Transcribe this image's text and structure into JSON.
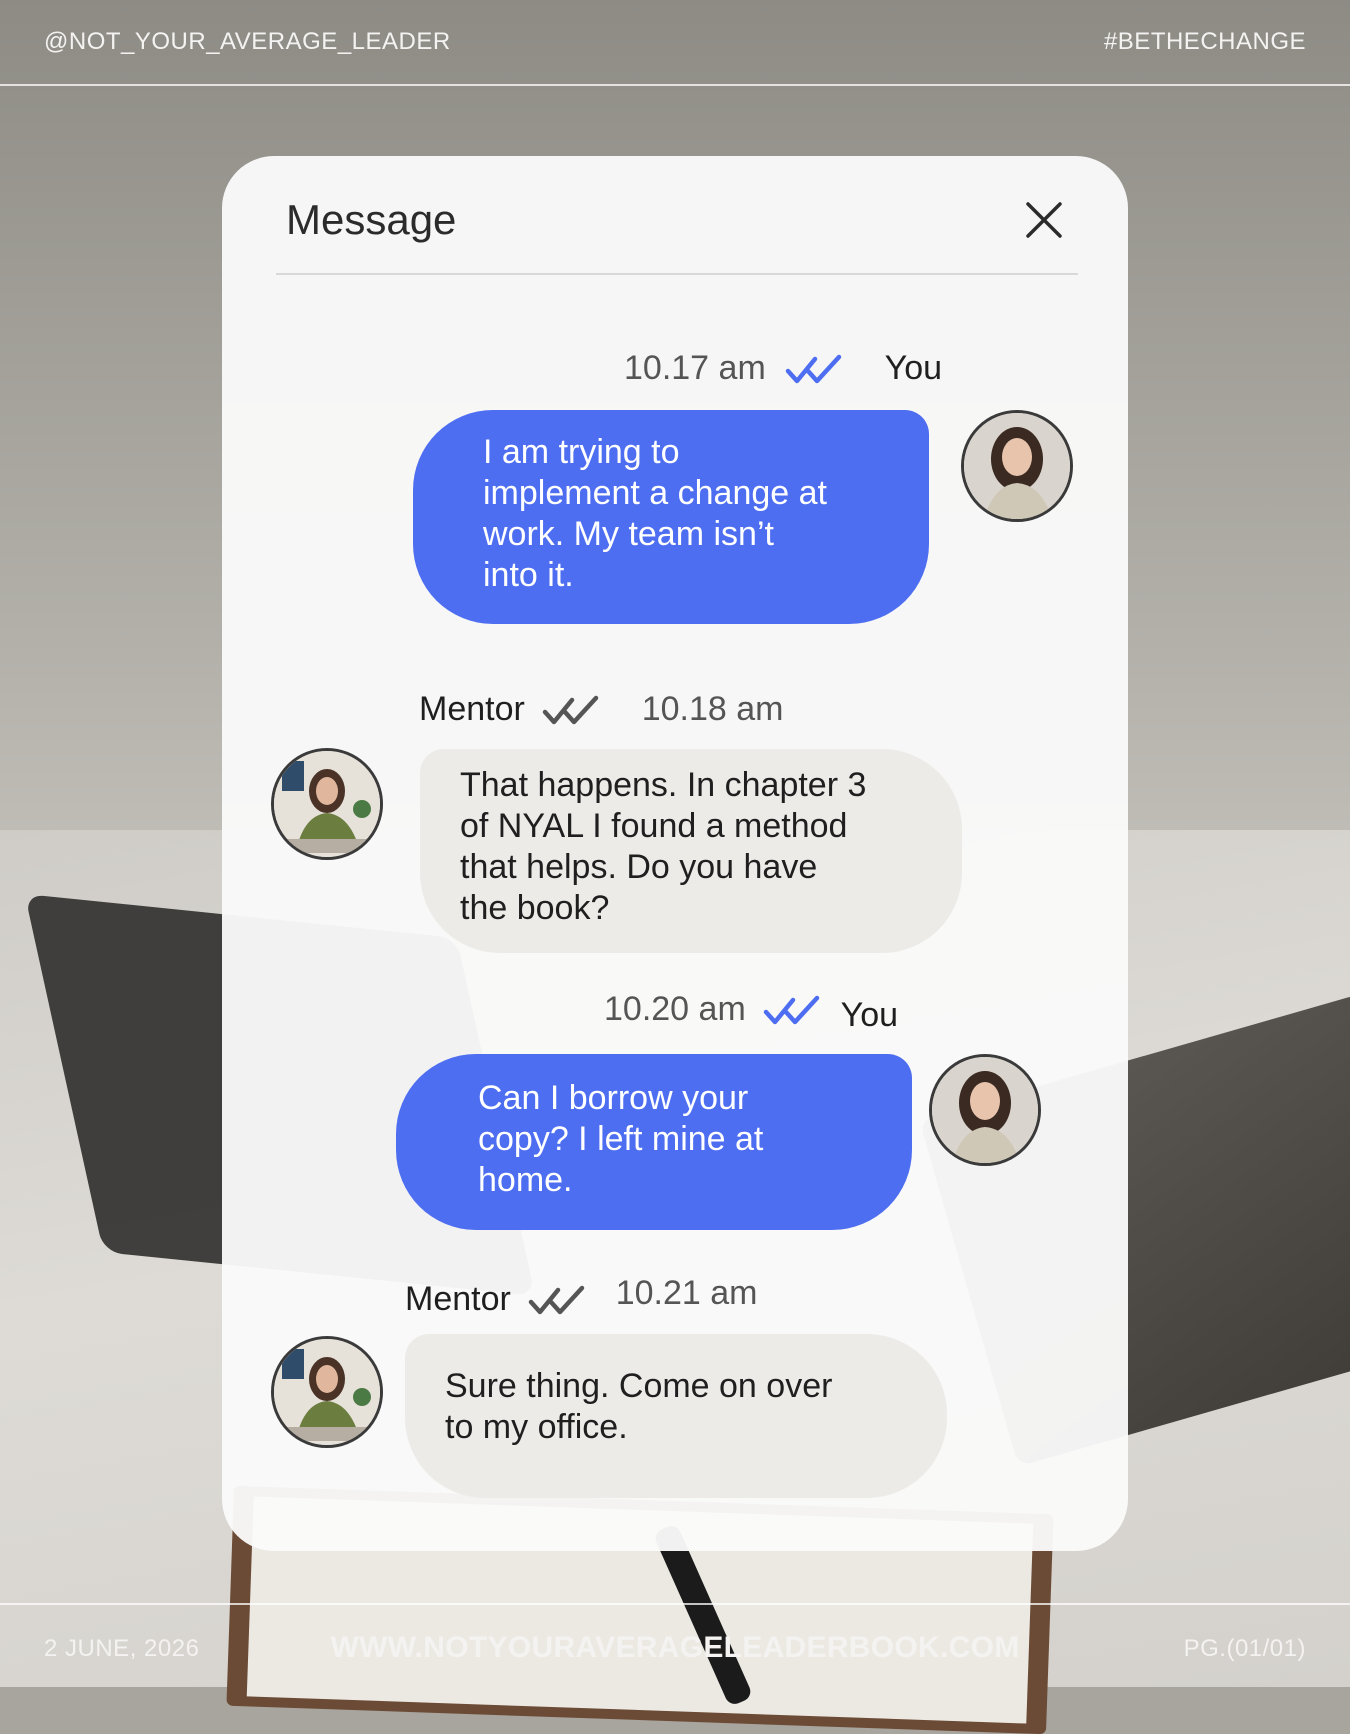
{
  "header": {
    "handle": "@NOT_YOUR_AVERAGE_LEADER",
    "hashtag": "#BETHECHANGE"
  },
  "footer": {
    "date": "2 JUNE, 2026",
    "website": "WWW.NOTYOURAVERAGELEADERBOOK.COM",
    "page": "PG.(01/01)"
  },
  "dialog": {
    "title": "Message",
    "close_icon": "close-icon"
  },
  "colors": {
    "outgoing_bubble": "#4e6ef2",
    "incoming_bubble": "#ecebe8",
    "read_tick_blue": "#4e6ef2",
    "read_tick_gray": "#555555"
  },
  "messages": [
    {
      "direction": "outgoing",
      "sender": "You",
      "time": "10.17 am",
      "status_icon": "double-check-icon",
      "lines": [
        "I am trying to",
        "implement a change at",
        "work. My team isn’t",
        "into it."
      ]
    },
    {
      "direction": "incoming",
      "sender": "Mentor",
      "time": "10.18 am",
      "status_icon": "double-check-icon",
      "lines": [
        "That happens. In chapter 3",
        "of NYAL I found a method",
        "that helps. Do you have",
        "the book?"
      ]
    },
    {
      "direction": "outgoing",
      "sender": "You",
      "time": "10.20 am",
      "status_icon": "double-check-icon",
      "lines": [
        "Can I borrow your",
        "copy? I left mine at",
        "home."
      ]
    },
    {
      "direction": "incoming",
      "sender": "Mentor",
      "time": "10.21 am",
      "status_icon": "double-check-icon",
      "lines": [
        "Sure thing. Come on over",
        "to my office."
      ]
    }
  ]
}
